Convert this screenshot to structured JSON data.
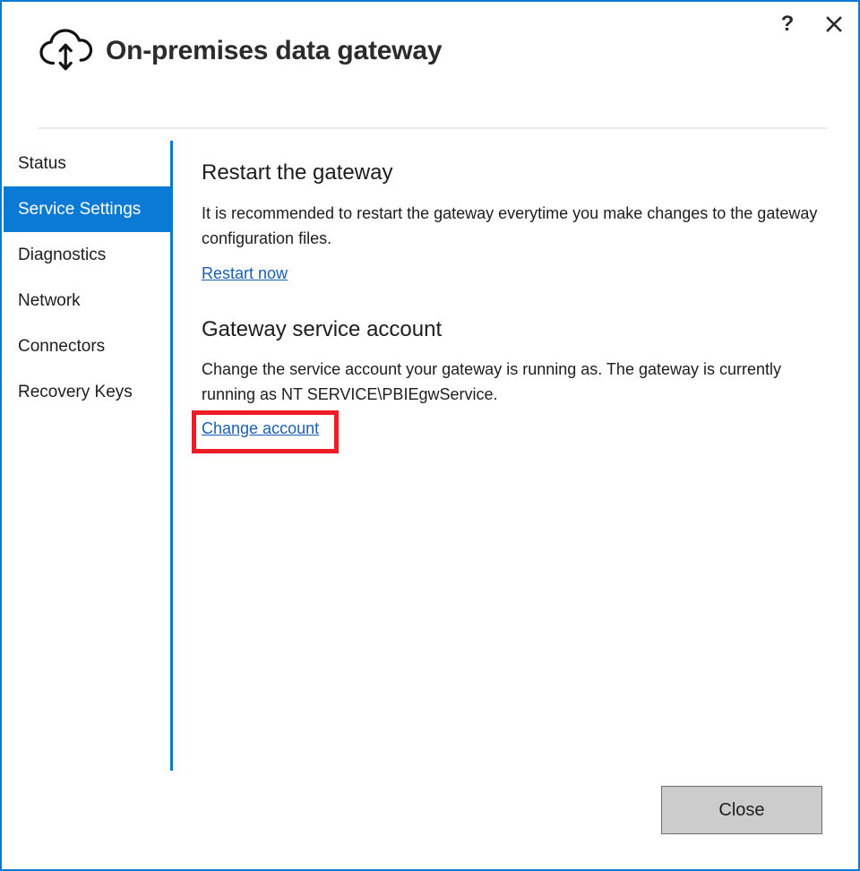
{
  "window": {
    "title": "On-premises data gateway",
    "accent_color": "#0a7ad4",
    "border_color": "#0a7ad4",
    "help_icon": "question-mark-icon",
    "close_icon": "close-x-icon",
    "logo_icon": "cloud-up-down-arrow-icon"
  },
  "titlebar": {
    "help_label": "?",
    "close_label": "✕"
  },
  "sidebar": {
    "items": [
      {
        "label": "Status",
        "selected": false
      },
      {
        "label": "Service Settings",
        "selected": true
      },
      {
        "label": "Diagnostics",
        "selected": false
      },
      {
        "label": "Network",
        "selected": false
      },
      {
        "label": "Connectors",
        "selected": false
      },
      {
        "label": "Recovery Keys",
        "selected": false
      }
    ]
  },
  "main": {
    "restart_section": {
      "title": "Restart the gateway",
      "body": "It is recommended to restart the gateway everytime you make changes to the gateway configuration files.",
      "link_label": "Restart now"
    },
    "account_section": {
      "title": "Gateway service account",
      "body": "Change the service account your gateway is running as. The gateway is currently running as NT SERVICE\\PBIEgwService.",
      "link_label": "Change account"
    }
  },
  "annotation": {
    "highlight_target": "Change account",
    "highlight_color": "#ee1c25"
  },
  "footer": {
    "close_label": "Close"
  }
}
